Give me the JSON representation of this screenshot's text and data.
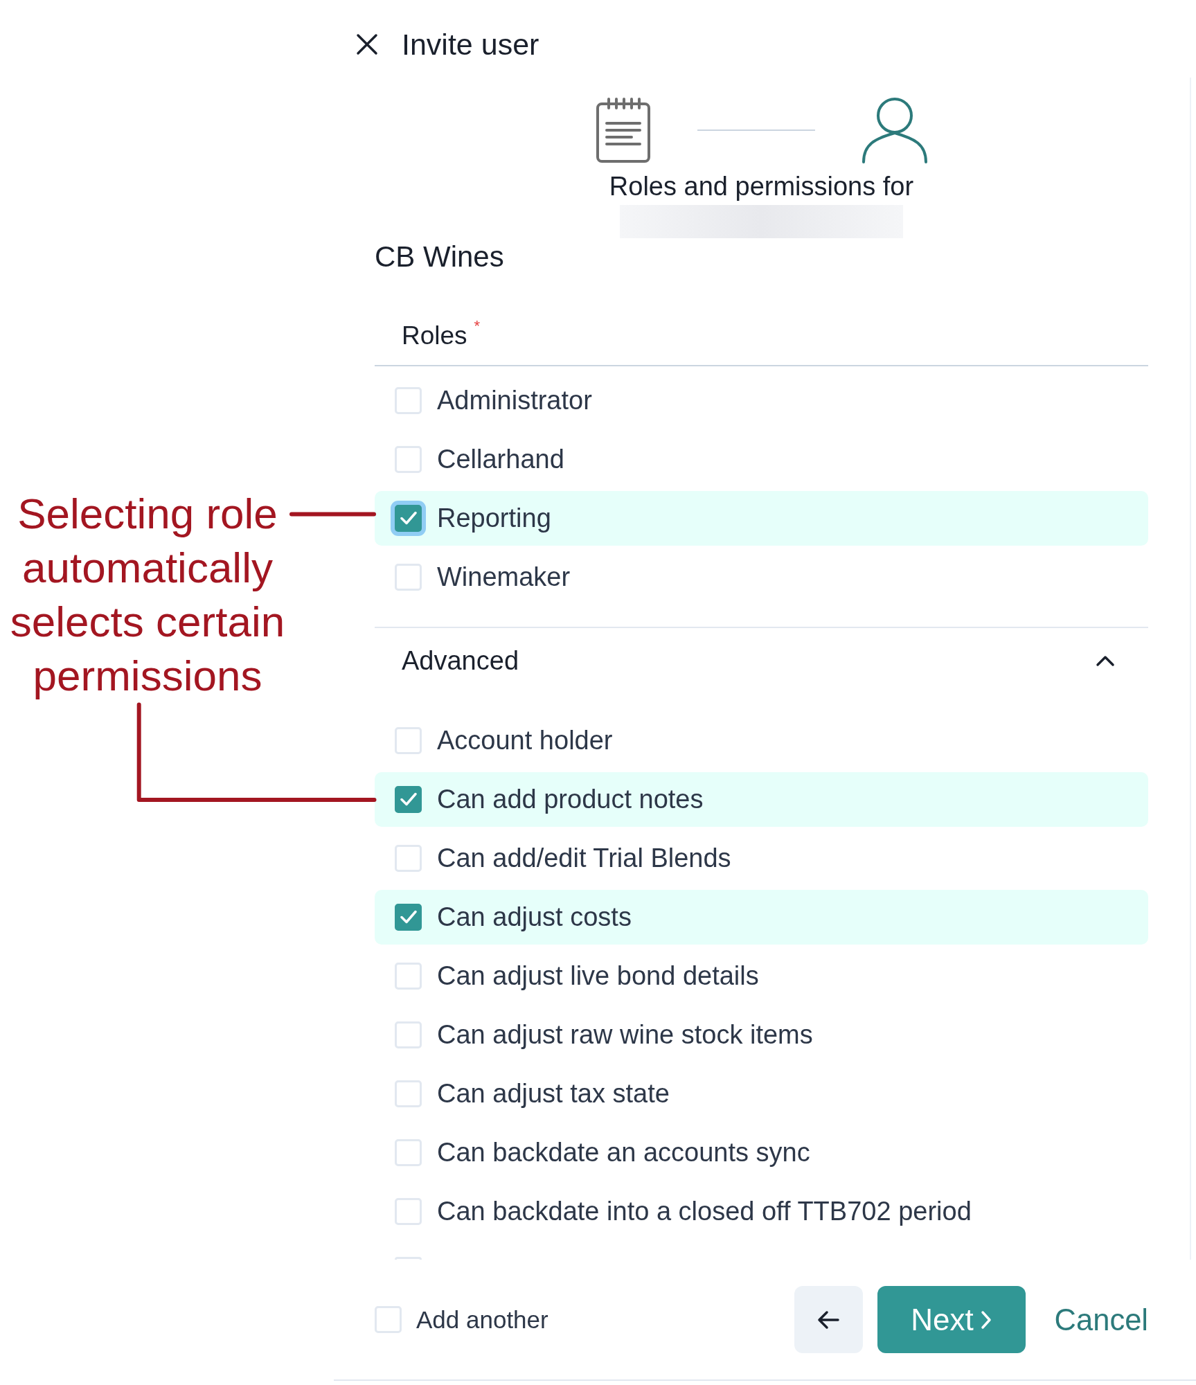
{
  "dialog": {
    "title": "Invite user"
  },
  "stepper": {
    "steps": [
      {
        "kind": "notes",
        "selected": false
      },
      {
        "kind": "user",
        "selected": true
      }
    ],
    "caption": "Roles and permissions for",
    "name_redacted": true
  },
  "organization": "CB Wines",
  "roles": {
    "label": "Roles",
    "required_mark": "*",
    "items": [
      {
        "label": "Administrator",
        "checked": false,
        "focused": false
      },
      {
        "label": "Cellarhand",
        "checked": false,
        "focused": false
      },
      {
        "label": "Reporting",
        "checked": true,
        "focused": true
      },
      {
        "label": "Winemaker",
        "checked": false,
        "focused": false
      }
    ]
  },
  "permissions": {
    "label": "Advanced",
    "expanded": true,
    "more_below": true,
    "items": [
      {
        "label": "Account holder",
        "checked": false
      },
      {
        "label": "Can add product notes",
        "checked": true
      },
      {
        "label": "Can add/edit Trial Blends",
        "checked": false
      },
      {
        "label": "Can adjust costs",
        "checked": true
      },
      {
        "label": "Can adjust live bond details",
        "checked": false
      },
      {
        "label": "Can adjust raw wine stock items",
        "checked": false
      },
      {
        "label": "Can adjust tax state",
        "checked": false
      },
      {
        "label": "Can backdate an accounts sync",
        "checked": false
      },
      {
        "label": "Can backdate into a closed off TTB702 period",
        "checked": false
      }
    ]
  },
  "footer": {
    "add_another": {
      "label": "Add another",
      "checked": false
    },
    "buttons": [
      {
        "kind": "back"
      },
      {
        "kind": "next",
        "label": "Next"
      },
      {
        "kind": "cancel",
        "label": "Cancel"
      }
    ]
  },
  "annotation": {
    "text": "Selecting role automatically selects certain permissions"
  }
}
